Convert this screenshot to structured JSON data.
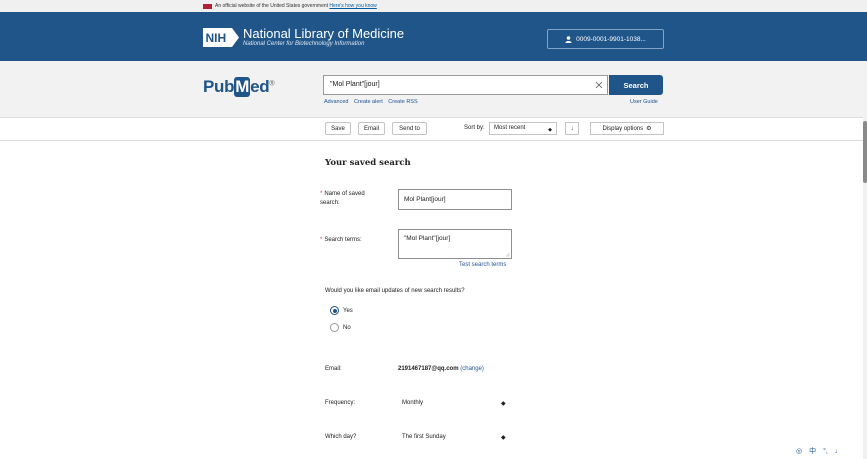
{
  "gov_banner": {
    "text": "An official website of the United States government",
    "link": "Here's how you know"
  },
  "header": {
    "logo": "NIH",
    "title": "National Library of Medicine",
    "subtitle": "National Center for Biotechnology Information",
    "account": "0009-0001-9901-1038..."
  },
  "search": {
    "logo_pre": "Pub",
    "logo_mark": "M",
    "logo_post": "ed",
    "logo_reg": "®",
    "query": "\"Mol Plant\"[jour]",
    "button": "Search",
    "links": [
      "Advanced",
      "Create alert",
      "Create RSS"
    ],
    "user_guide": "User Guide"
  },
  "toolbar": {
    "save": "Save",
    "email": "Email",
    "send_to": "Send to",
    "sort_label": "Sort by:",
    "sort_value": "Most recent",
    "display_options": "Display options"
  },
  "form": {
    "title": "Your saved search",
    "name_label": "Name of saved search:",
    "name_value": "Mol Plant[jour]",
    "terms_label": "Search terms:",
    "terms_value": "\"Mol Plant\"[jour]",
    "test_link": "Test search terms",
    "updates_question": "Would you like email updates of new search results?",
    "yes": "Yes",
    "no": "No",
    "email_label": "Email:",
    "email_value": "2191467187@qq.com",
    "email_change": "(change)",
    "frequency_label": "Frequency:",
    "frequency_value": "Monthly",
    "day_label": "Which day?",
    "day_value": "The first Sunday"
  },
  "tray": {
    "lang": "中"
  },
  "colors": {
    "header_bg": "#20558a",
    "link": "#205493",
    "required": "#d83933"
  }
}
